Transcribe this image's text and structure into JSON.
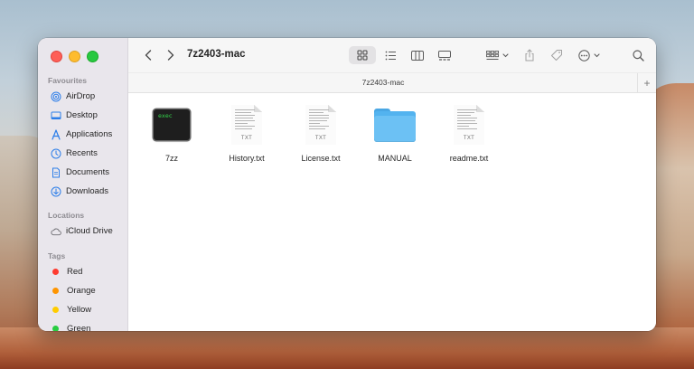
{
  "window": {
    "title": "7z2403-mac",
    "path_label": "7z2403-mac"
  },
  "sidebar": {
    "sections": [
      {
        "heading": "Favourites",
        "items": [
          {
            "label": "AirDrop",
            "icon": "airdrop-icon"
          },
          {
            "label": "Desktop",
            "icon": "desktop-icon"
          },
          {
            "label": "Applications",
            "icon": "applications-icon"
          },
          {
            "label": "Recents",
            "icon": "recents-icon"
          },
          {
            "label": "Documents",
            "icon": "documents-icon"
          },
          {
            "label": "Downloads",
            "icon": "downloads-icon"
          }
        ]
      },
      {
        "heading": "Locations",
        "items": [
          {
            "label": "iCloud Drive",
            "icon": "icloud-icon"
          }
        ]
      },
      {
        "heading": "Tags",
        "items": [
          {
            "label": "Red",
            "color": "#fe3b30"
          },
          {
            "label": "Orange",
            "color": "#fe9500"
          },
          {
            "label": "Yellow",
            "color": "#ffcc00"
          },
          {
            "label": "Green",
            "color": "#28cd41"
          }
        ]
      }
    ]
  },
  "files": [
    {
      "name": "7zz",
      "kind": "exec",
      "thumb_label": "exec"
    },
    {
      "name": "History.txt",
      "kind": "txt",
      "thumb_label": "TXT"
    },
    {
      "name": "License.txt",
      "kind": "txt",
      "thumb_label": "TXT"
    },
    {
      "name": "MANUAL",
      "kind": "folder"
    },
    {
      "name": "readme.txt",
      "kind": "txt",
      "thumb_label": "TXT"
    }
  ],
  "accent": "#0a84ff"
}
